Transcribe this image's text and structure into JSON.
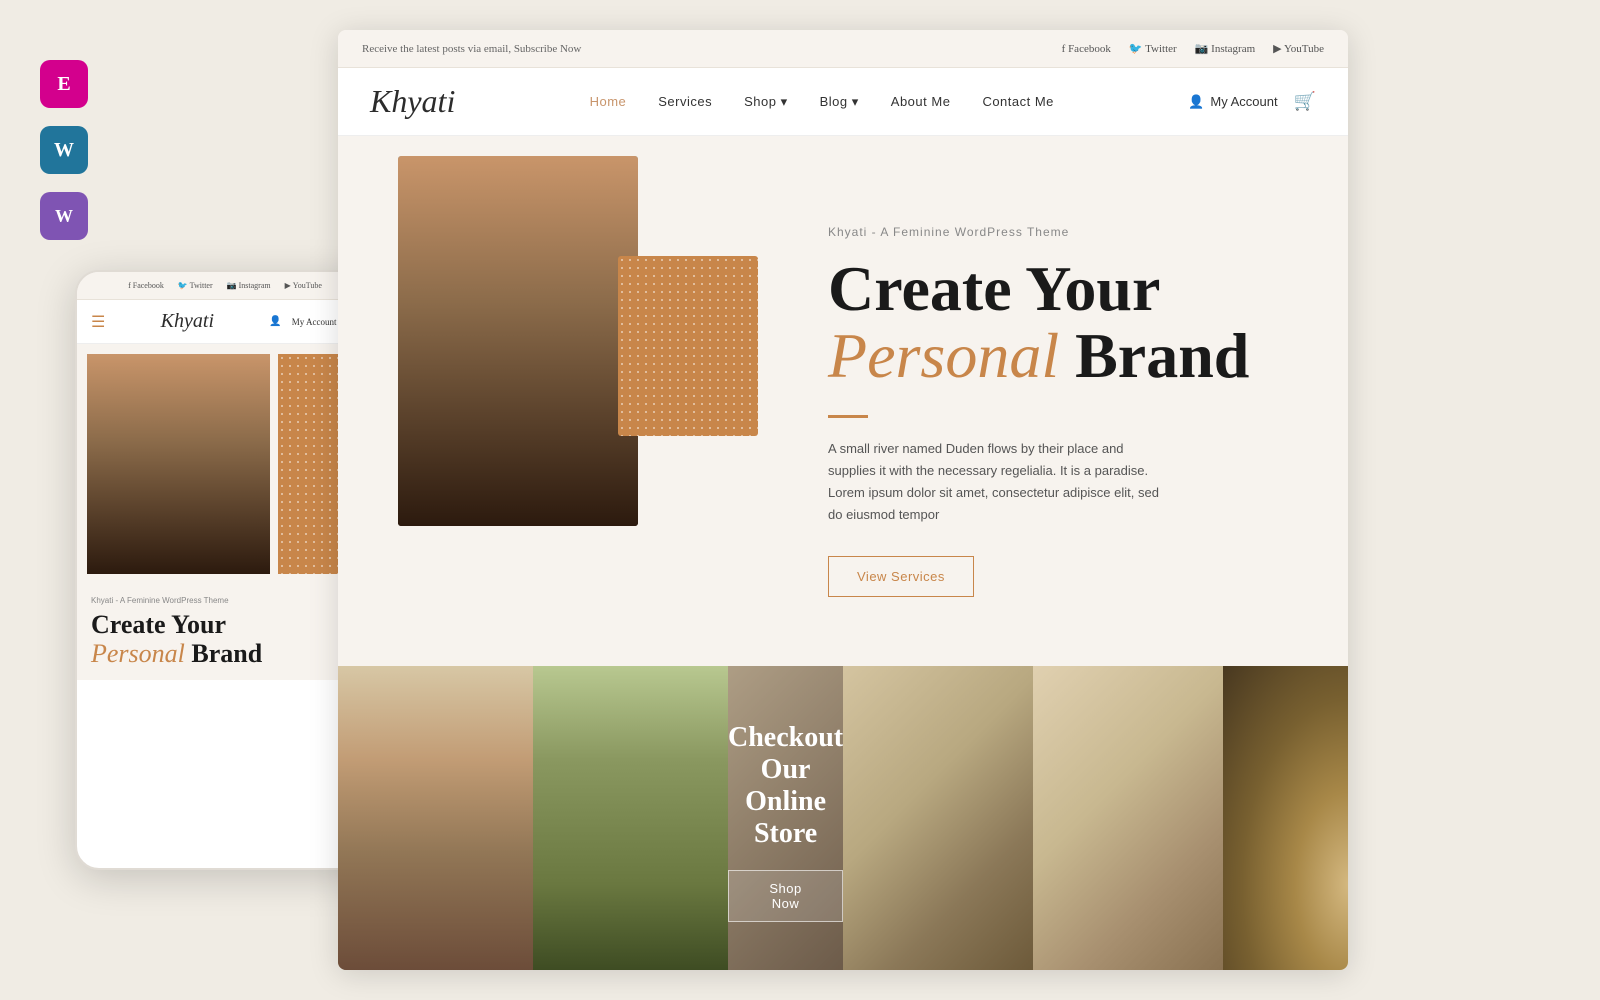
{
  "sidebar": {
    "icons": [
      {
        "name": "elementor-icon",
        "label": "E",
        "class": "icon-elementor"
      },
      {
        "name": "wordpress-icon",
        "label": "W",
        "class": "icon-wordpress"
      },
      {
        "name": "woo-icon",
        "label": "W",
        "class": "icon-woo"
      }
    ]
  },
  "topbar": {
    "subscribe_text": "Receive the latest posts via email, Subscribe Now",
    "social_links": [
      {
        "name": "Facebook",
        "icon": "f"
      },
      {
        "name": "Twitter",
        "icon": "🐦"
      },
      {
        "name": "Instagram",
        "icon": "📷"
      },
      {
        "name": "YouTube",
        "icon": "▶"
      }
    ]
  },
  "nav": {
    "logo": "Khyati",
    "links": [
      {
        "label": "Home",
        "active": true
      },
      {
        "label": "Services",
        "active": false
      },
      {
        "label": "Shop",
        "active": false,
        "dropdown": true
      },
      {
        "label": "Blog",
        "active": false,
        "dropdown": true
      },
      {
        "label": "About Me",
        "active": false
      },
      {
        "label": "Contact Me",
        "active": false
      }
    ],
    "account_label": "My Account",
    "cart_icon": "🛒"
  },
  "hero": {
    "subtitle": "Khyati - A Feminine WordPress Theme",
    "title_line1": "Create Your",
    "title_italic": "Personal",
    "title_bold": "Brand",
    "divider": true,
    "description": "A small river named Duden flows by their place and supplies it with the necessary regelialia. It is a paradise. Lorem ipsum dolor sit amet, consectetur adipisce elit, sed do eiusmod tempor",
    "cta_button": "View Services"
  },
  "mobile": {
    "top_social": [
      "Facebook",
      "Twitter",
      "Instagram",
      "YouTube"
    ],
    "logo": "Khyati",
    "account_label": "My Account",
    "subtitle": "Khyati - A Feminine WordPress Theme",
    "title_line1": "Create Your",
    "title_italic": "Personal",
    "title_bold": "Brand"
  },
  "bottom_section": {
    "title": "Checkout Our Online Store",
    "shop_button": "Shop Now"
  }
}
